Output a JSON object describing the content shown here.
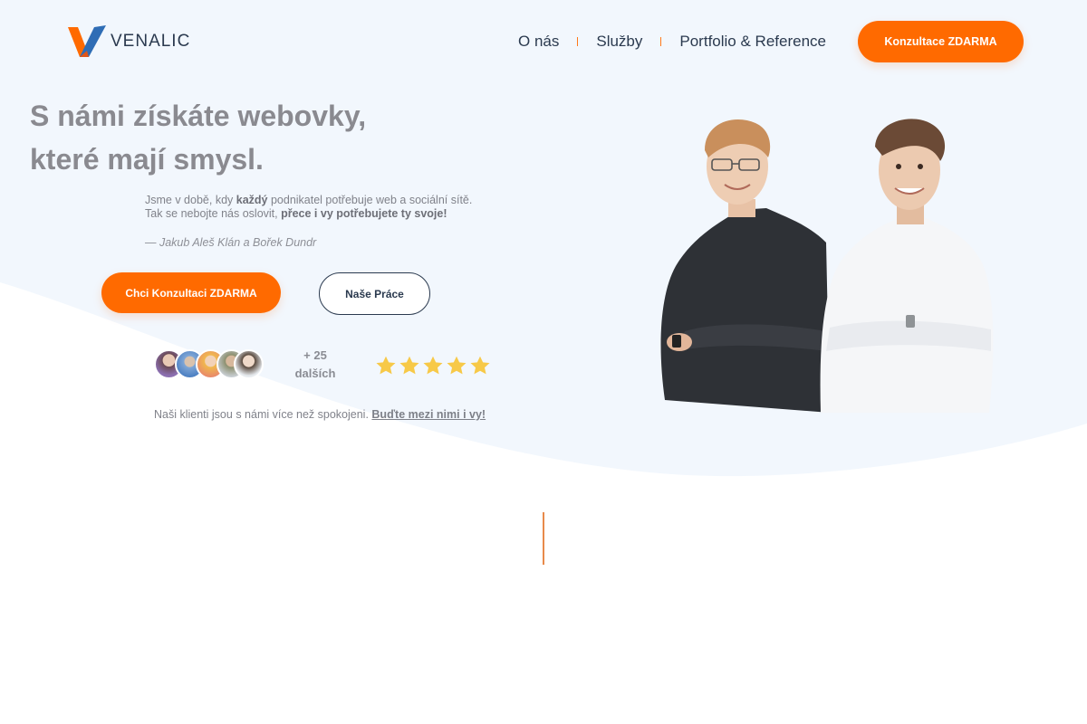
{
  "brand": {
    "name": "VENALIC",
    "accent": "#ff6a00",
    "logo_blue": "#2f6db5"
  },
  "nav": {
    "items": [
      {
        "label": "O nás"
      },
      {
        "label": "Služby"
      },
      {
        "label": "Portfolio & Reference"
      }
    ],
    "cta_label": "Konzultace ZDARMA"
  },
  "hero": {
    "title_line1": "S námi získáte webovky,",
    "title_line2": "které mají smysl.",
    "intro": {
      "p1_a": "Jsme v době, kdy ",
      "p1_bold": "každý",
      "p1_b": " podnikatel potřebuje web a sociální sítě.",
      "p2_a": "Tak se nebojte nás oslovit, ",
      "p2_bold": "přece i vy potřebujete ty svoje!"
    },
    "quote": "— Jakub Aleš Klán a Bořek Dundr",
    "primary_button": "Chci Konzultaci ZDARMA",
    "secondary_button": "Naše Práce"
  },
  "social_proof": {
    "count_line1": "+ 25",
    "count_line2": "dalších",
    "rating_stars": 5,
    "note": "Naši klienti jsou s námi více než spokojeni.",
    "note_link": "Buďte mezi nimi i vy!"
  },
  "icons": {
    "star": "star-icon",
    "logo": "venalic-v-logo"
  }
}
